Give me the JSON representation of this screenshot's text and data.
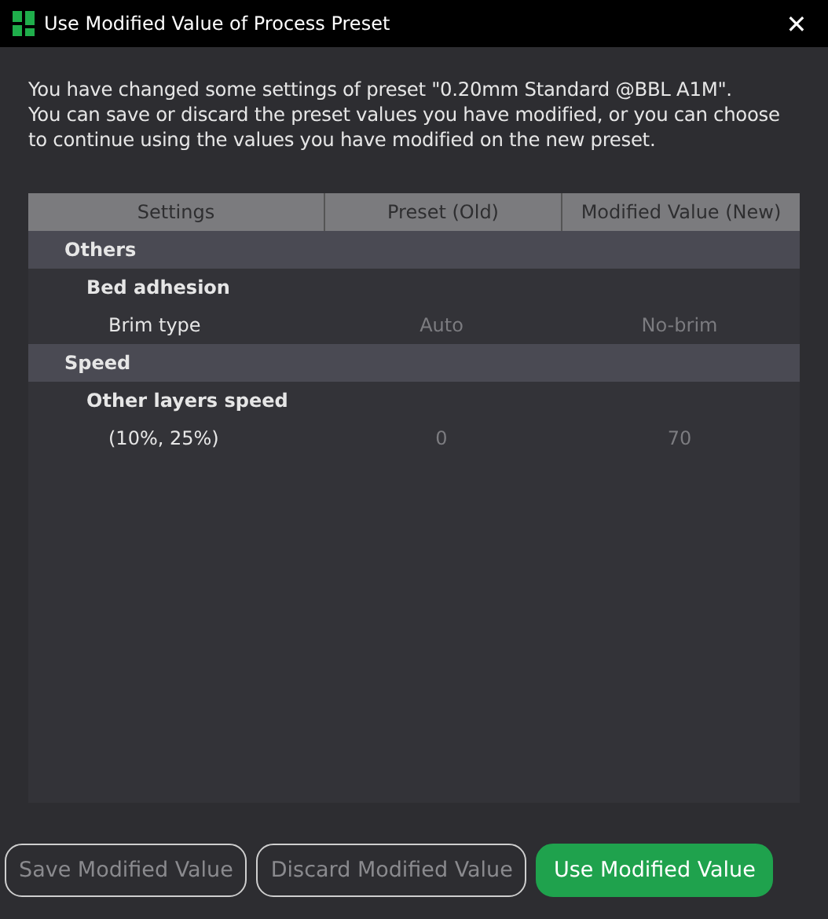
{
  "window": {
    "title": "Use Modified Value of Process Preset",
    "close": "✕"
  },
  "message": [
    "You have changed some settings of preset \"0.20mm Standard @BBL A1M\".",
    "You can save or discard the preset values you have modified, or you can choose to continue using the values you have modified on the new preset."
  ],
  "table": {
    "columns": [
      "Settings",
      "Preset (Old)",
      "Modified Value (New)"
    ],
    "rows": [
      {
        "kind": "group",
        "label": "Others"
      },
      {
        "kind": "subgroup",
        "label": "Bed adhesion"
      },
      {
        "kind": "option",
        "label": "Brim type",
        "old": "Auto",
        "new": "No-brim"
      },
      {
        "kind": "group",
        "label": "Speed"
      },
      {
        "kind": "subgroup",
        "label": "Other layers speed"
      },
      {
        "kind": "option",
        "label": "(10%, 25%)",
        "old": "0",
        "new": "70"
      }
    ]
  },
  "buttons": [
    {
      "label": "Save Modified Value",
      "primary": false
    },
    {
      "label": "Discard Modified Value",
      "primary": false
    },
    {
      "label": "Use Modified Value",
      "primary": true
    }
  ]
}
